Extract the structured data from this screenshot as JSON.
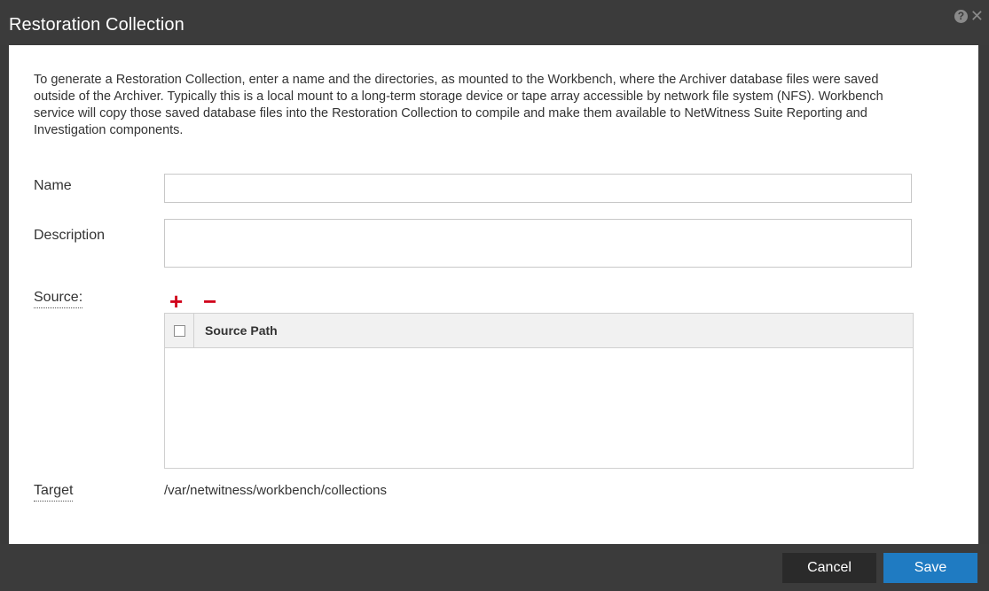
{
  "dialog": {
    "title": "Restoration Collection",
    "icons": [
      "help-icon",
      "close-icon"
    ],
    "intro": "To generate a Restoration Collection, enter a name and the directories, as mounted to the Workbench, where the Archiver database files were saved outside of the Archiver. Typically this is a local mount to a long-term storage device or tape array accessible by network file system (NFS). Workbench service will copy those saved database files into the Restoration Collection to compile and make them available to NetWitness Suite Reporting and Investigation components."
  },
  "form": {
    "name_label": "Name",
    "name_value": "",
    "description_label": "Description",
    "description_value": "",
    "source_label": "Source:",
    "add_symbol": "+",
    "remove_symbol": "−",
    "source_columns": [
      "Source Path"
    ],
    "source_rows": [],
    "target_label": "Target",
    "target_value": "/var/netwitness/workbench/collections"
  },
  "footer": {
    "cancel_label": "Cancel",
    "save_label": "Save"
  },
  "colors": {
    "titlebar": "#3b3b3b",
    "accent_save": "#1f7bc2",
    "add_remove": "#d0021b"
  }
}
